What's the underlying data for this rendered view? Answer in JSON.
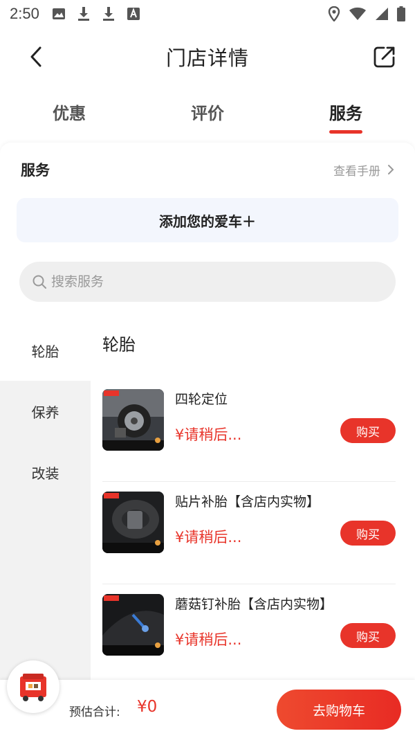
{
  "status_bar": {
    "time": "2:50",
    "left_icons": [
      "image-icon",
      "download-icon",
      "download-icon",
      "font-icon"
    ],
    "right_icons": [
      "location-icon",
      "wifi-icon",
      "signal-icon",
      "battery-icon"
    ]
  },
  "header": {
    "title": "门店详情"
  },
  "tabs": [
    {
      "label": "优惠",
      "active": false
    },
    {
      "label": "评价",
      "active": false
    },
    {
      "label": "服务",
      "active": true
    }
  ],
  "section": {
    "title": "服务",
    "manual_link": "查看手册"
  },
  "add_car": {
    "label": "添加您的爱车＋"
  },
  "search": {
    "placeholder": "搜索服务"
  },
  "categories": [
    {
      "label": "轮胎",
      "active": true
    },
    {
      "label": "保养",
      "active": false
    },
    {
      "label": "改装",
      "active": false
    }
  ],
  "list": {
    "category_title": "轮胎",
    "items": [
      {
        "name": "四轮定位",
        "price": "¥请稍后...",
        "button": "购买",
        "thumb_icon": "wheel-alignment-thumbnail"
      },
      {
        "name": "贴片补胎【含店内实物】",
        "price": "¥请稍后...",
        "button": "购买",
        "thumb_icon": "patch-repair-thumbnail"
      },
      {
        "name": "蘑菇钉补胎【含店内实物】",
        "price": "¥请稍后...",
        "button": "购买",
        "thumb_icon": "plug-repair-thumbnail"
      }
    ]
  },
  "bottom_bar": {
    "total_label": "预估合计:",
    "total_value": "¥0",
    "checkout_label": "去购物车"
  },
  "colors": {
    "accent": "#e8342a",
    "search_bg": "#efefef",
    "add_car_bg": "#f3f6fd",
    "sidebar_bg": "#f2f2f2"
  }
}
